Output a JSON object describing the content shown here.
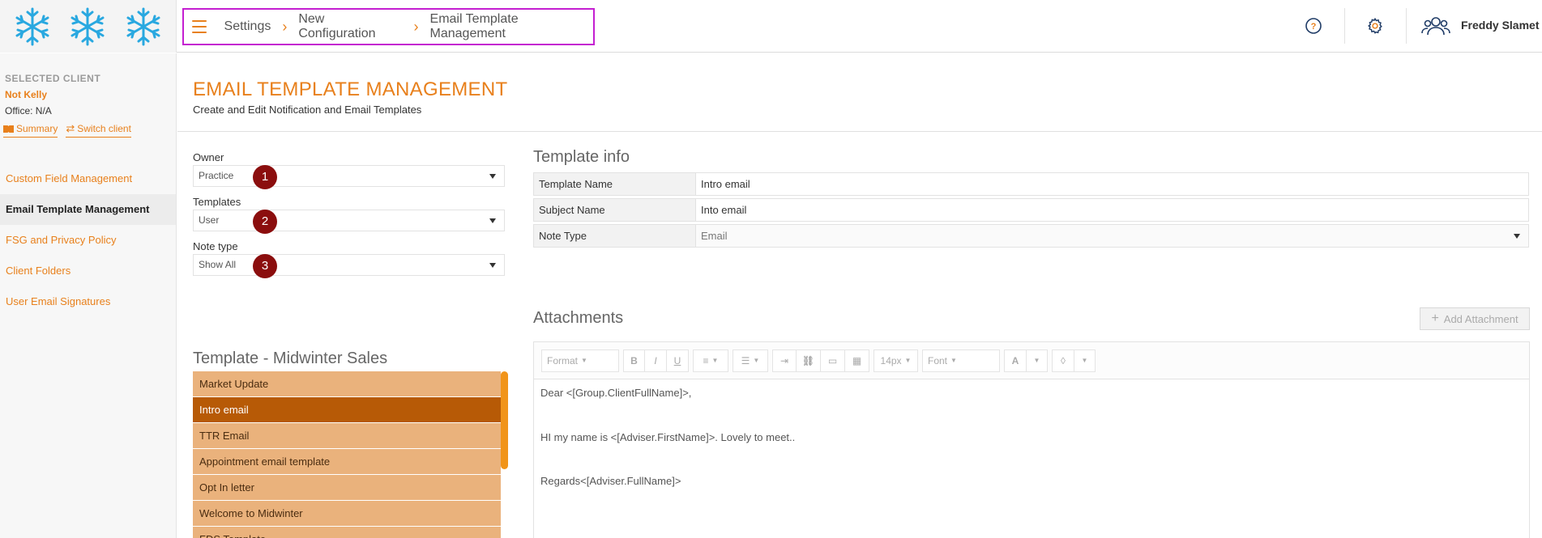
{
  "header": {
    "breadcrumb": [
      "Settings",
      "New Configuration",
      "Email Template Management"
    ],
    "user_name": "Freddy Slamet",
    "help_icon": "question-circle-icon",
    "settings_icon": "gear-icon",
    "user_icon": "users-icon"
  },
  "sidebar": {
    "selected_client_label": "SELECTED CLIENT",
    "client_name": "Not Kelly",
    "office": "Office: N/A",
    "summary_link": "Summary",
    "switch_client_link": "Switch client",
    "items": [
      {
        "label": "Custom Field Management",
        "active": false
      },
      {
        "label": "Email Template Management",
        "active": true
      },
      {
        "label": "FSG and Privacy Policy",
        "active": false
      },
      {
        "label": "Client Folders",
        "active": false
      },
      {
        "label": "User Email Signatures",
        "active": false
      }
    ]
  },
  "main": {
    "title": "EMAIL TEMPLATE MANAGEMENT",
    "subtitle": "Create and Edit Notification and Email Templates",
    "filters": {
      "owner_label": "Owner",
      "owner_value": "Practice",
      "templates_label": "Templates",
      "templates_value": "User",
      "note_type_label": "Note type",
      "note_type_value": "Show All",
      "badges": [
        "1",
        "2",
        "3"
      ]
    },
    "template_info": {
      "title": "Template info",
      "rows": [
        {
          "key": "Template Name",
          "value": "Intro email"
        },
        {
          "key": "Subject Name",
          "value": "Into email"
        },
        {
          "key": "Note Type",
          "value": "Email"
        }
      ]
    },
    "attachments": {
      "title": "Attachments",
      "add_button": "Add Attachment"
    },
    "editor": {
      "toolbar": {
        "format": "Format",
        "bold": "B",
        "italic": "I",
        "underline": "U",
        "font_size": "14px",
        "font": "Font",
        "color": "A"
      },
      "lines": [
        "Dear <[Group.ClientFullName]>,",
        "HI my name is <[Adviser.FirstName]>. Lovely to meet..",
        "Regards<[Adviser.FullName]>"
      ]
    },
    "template_list": {
      "title": "Template - Midwinter Sales",
      "items": [
        {
          "label": "Market Update",
          "selected": false
        },
        {
          "label": "Intro email",
          "selected": true
        },
        {
          "label": "TTR Email",
          "selected": false
        },
        {
          "label": "Appointment email template",
          "selected": false
        },
        {
          "label": "Opt In letter",
          "selected": false
        },
        {
          "label": "Welcome to Midwinter",
          "selected": false
        },
        {
          "label": "FDS Template",
          "selected": false
        }
      ]
    }
  },
  "colors": {
    "accent": "#e8801c",
    "highlight_border": "#c41fd1",
    "badge": "#8b0e0e",
    "list_item": "#eab27c",
    "list_selected": "#b75a06"
  }
}
